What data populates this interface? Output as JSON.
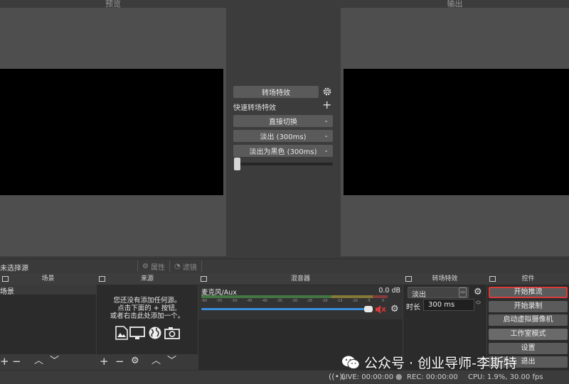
{
  "preview": {
    "title": "预览"
  },
  "output": {
    "title": "输出"
  },
  "transition_panel": {
    "transition_effects_label": "转场特效",
    "quick_transitions_label": "快速转场特效",
    "cut_label": "直接切换",
    "fade_label": "淡出 (300ms)",
    "fade_to_black_label": "淡出为黑色 (300ms)",
    "tbar_value": 0
  },
  "source_bar": {
    "status": "未选择源",
    "properties_label": "属性",
    "filters_label": "滤镜"
  },
  "scenes": {
    "title": "场景",
    "items": [
      "场景"
    ]
  },
  "sources": {
    "title": "来源",
    "empty_text": [
      "您还没有添加任何源。",
      "点击下面的 + 按钮,",
      "或者右击此处添加一个。"
    ]
  },
  "mixer": {
    "title": "混音器",
    "channel_name": "麦克风/Aux",
    "level": "0.0 dB",
    "ticks": [
      "-60",
      "-55",
      "-50",
      "-45",
      "-40",
      "-35",
      "-30",
      "-25",
      "-20",
      "-15",
      "-10",
      "-5",
      "0"
    ],
    "volume_fraction": 0.98,
    "muted": true
  },
  "transitions_dock": {
    "title": "转场特效",
    "selected": "淡出",
    "duration_label": "时长",
    "duration_value": "300 ms"
  },
  "controls": {
    "title": "控件",
    "start_streaming": "开始推流",
    "start_recording": "开始录制",
    "virtual_camera": "启动虚拟摄像机",
    "studio_mode": "工作室模式",
    "settings": "设置",
    "exit": "退出"
  },
  "statusbar": {
    "live": "LIVE: 00:00:00",
    "rec": "REC: 00:00:00",
    "cpu": "CPU: 1.9%, 30.00 fps"
  },
  "watermark": {
    "text": "公众号 · 创业导师-李斯特"
  },
  "colors": {
    "accent_red": "#d93a3a",
    "volume_blue": "#3a8edb",
    "meter_green": "#4fae4f",
    "meter_yellow": "#c9b33a",
    "meter_red": "#c94141"
  }
}
